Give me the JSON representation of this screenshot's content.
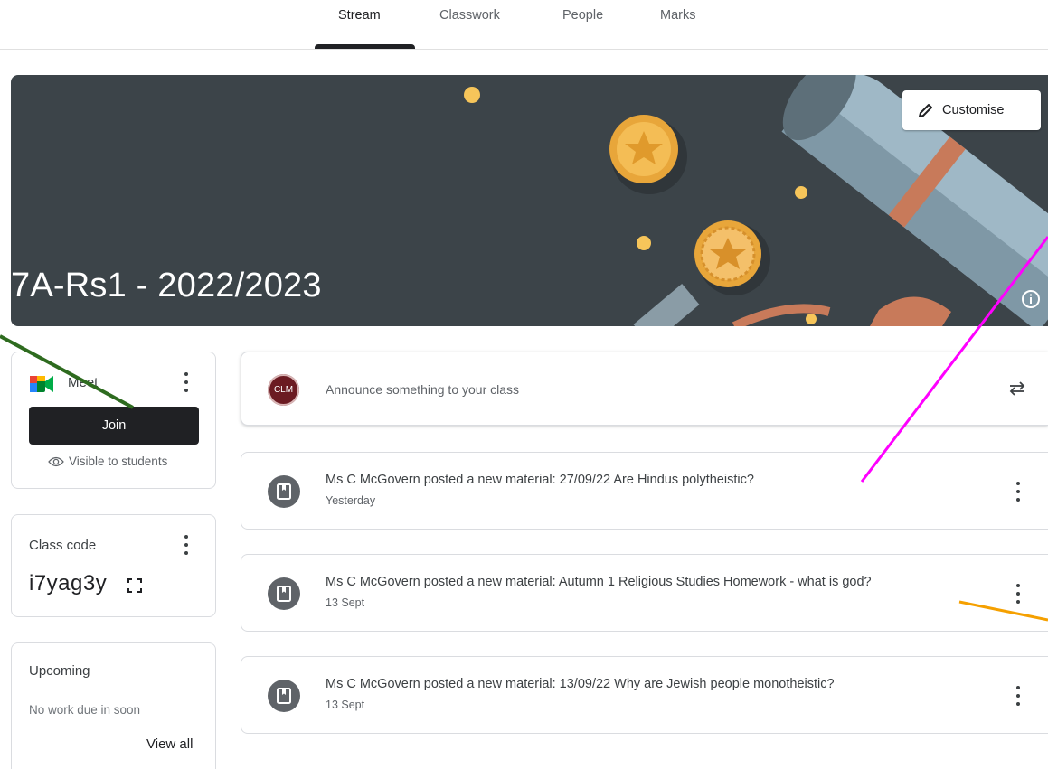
{
  "nav": {
    "tabs": [
      {
        "label": "Stream"
      },
      {
        "label": "Classwork"
      },
      {
        "label": "People"
      },
      {
        "label": "Marks"
      }
    ]
  },
  "banner": {
    "title": "7A-Rs1 - 2022/2023",
    "customise_label": "Customise",
    "info_icon": "info-icon",
    "background": "#3c4449"
  },
  "meet": {
    "title": "Meet",
    "join_label": "Join",
    "visibility": "Visible to students"
  },
  "class_code": {
    "label": "Class code",
    "value": "i7yag3y"
  },
  "upcoming": {
    "title": "Upcoming",
    "empty_text": "No work due in soon",
    "view_all": "View all"
  },
  "announce": {
    "avatar_initials": "CLM",
    "placeholder": "Announce something to your class"
  },
  "posts": [
    {
      "text": "Ms C McGovern posted a new material: 27/09/22 Are Hindus polytheistic?",
      "date": "Yesterday"
    },
    {
      "text": "Ms C McGovern posted a new material: Autumn 1 Religious Studies Homework - what is god?",
      "date": "13 Sept"
    },
    {
      "text": "Ms C McGovern posted a new material: 13/09/22 Why are Jewish people monotheistic?",
      "date": "13 Sept"
    }
  ],
  "colors": {
    "accent_dark": "#202124",
    "avatar": "#6b1b22",
    "annotation_green": "#2e6b1f",
    "annotation_magenta": "#ff00ff",
    "annotation_orange": "#f5a000"
  }
}
